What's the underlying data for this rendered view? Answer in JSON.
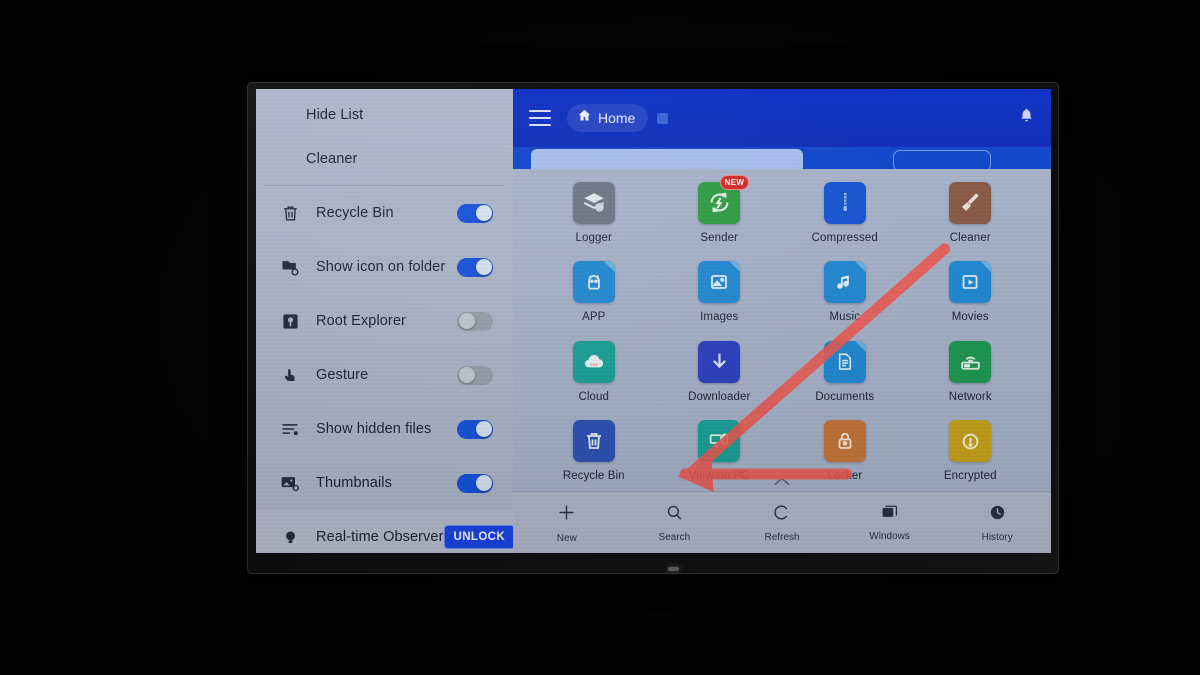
{
  "device": {
    "type": "monitor-photo",
    "bezel_color": "#111111",
    "led": "power-indicator"
  },
  "sidebar": {
    "menu_items": [
      {
        "label": "Hide List"
      },
      {
        "label": "Cleaner"
      }
    ],
    "settings": [
      {
        "label": "Recycle Bin",
        "icon": "trash-icon",
        "toggle": "on"
      },
      {
        "label": "Show icon on folder",
        "icon": "folder-badge-icon",
        "toggle": "on"
      },
      {
        "label": "Root Explorer",
        "icon": "root-key-icon",
        "toggle": "off"
      },
      {
        "label": "Gesture",
        "icon": "hand-tap-icon",
        "toggle": "off"
      },
      {
        "label": "Show hidden files",
        "icon": "lines-gear-icon",
        "toggle": "on"
      },
      {
        "label": "Thumbnails",
        "icon": "image-gear-icon",
        "toggle": "on"
      }
    ],
    "footer": {
      "label": "Real-time Observer",
      "icon": "bulb-icon",
      "button_label": "UNLOCK",
      "button_color": "#1a45e8"
    }
  },
  "header": {
    "menu_icon": "hamburger-icon",
    "breadcrumb": "Home",
    "home_icon": "home-icon",
    "notification_icon": "bell-icon",
    "background_color": "#0c2cba"
  },
  "grid": {
    "apps": [
      {
        "label": "Logger",
        "icon": "layers-icon",
        "color": "#6d7787"
      },
      {
        "label": "Sender",
        "icon": "send-sync-icon",
        "color": "#2f9e44",
        "badge": "NEW"
      },
      {
        "label": "Compressed",
        "icon": "zip-icon",
        "color": "#1554d6"
      },
      {
        "label": "Cleaner",
        "icon": "broom-icon",
        "color": "#8a5a46"
      },
      {
        "label": "APP",
        "icon": "android-icon",
        "color": "#1f8ad6"
      },
      {
        "label": "Images",
        "icon": "photo-icon",
        "color": "#1f8ad6"
      },
      {
        "label": "Music",
        "icon": "music-note-icon",
        "color": "#1f8ad6"
      },
      {
        "label": "Movies",
        "icon": "play-icon",
        "color": "#1f8ad6"
      },
      {
        "label": "Cloud",
        "icon": "cloud-icon",
        "color": "#17a39b"
      },
      {
        "label": "Downloader",
        "icon": "download-icon",
        "color": "#2b3fc4"
      },
      {
        "label": "Documents",
        "icon": "document-icon",
        "color": "#1f8ad6"
      },
      {
        "label": "Network",
        "icon": "router-icon",
        "color": "#1d9a52"
      },
      {
        "label": "Recycle Bin",
        "icon": "trash-icon",
        "color": "#2b52b8"
      },
      {
        "label": "View on PC",
        "icon": "monitor-phone-icon",
        "color": "#17a39b"
      },
      {
        "label": "Locker",
        "icon": "padlock-icon",
        "color": "#c8783a"
      },
      {
        "label": "Encrypted",
        "icon": "key-lock-icon",
        "color": "#c9a419"
      }
    ]
  },
  "bottom_bar": {
    "handle_icon": "chevron-up-icon",
    "items": [
      {
        "label": "New",
        "icon": "plus-icon"
      },
      {
        "label": "Search",
        "icon": "search-icon"
      },
      {
        "label": "Refresh",
        "icon": "refresh-icon"
      },
      {
        "label": "Windows",
        "icon": "windows-stack-icon"
      },
      {
        "label": "History",
        "icon": "clock-icon"
      }
    ]
  },
  "annotation": {
    "color": "#f2584f",
    "shape": "arrow-pointing-to-recycle-bin"
  }
}
